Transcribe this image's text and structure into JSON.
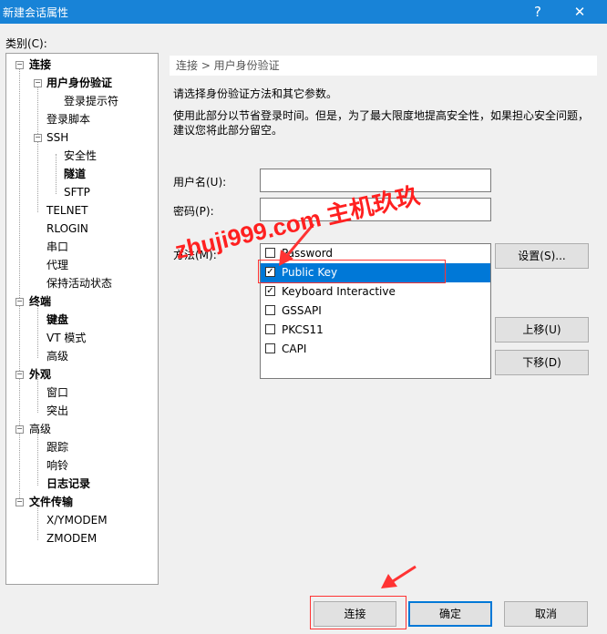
{
  "window": {
    "title": "新建会话属性",
    "help_button": "?",
    "close_button": "✕"
  },
  "category_label": "类别(C):",
  "tree": {
    "connection": "连接",
    "user_auth": "用户身份验证",
    "login_prompt": "登录提示符",
    "login_script": "登录脚本",
    "ssh": "SSH",
    "security": "安全性",
    "tunnel": "隧道",
    "sftp": "SFTP",
    "telnet": "TELNET",
    "rlogin": "RLOGIN",
    "serial": "串口",
    "proxy": "代理",
    "keepalive": "保持活动状态",
    "terminal": "终端",
    "keyboard": "键盘",
    "vt_mode": "VT 模式",
    "terminal_advanced": "高级",
    "appearance": "外观",
    "window": "窗口",
    "highlight": "突出",
    "advanced": "高级",
    "trace": "跟踪",
    "bell": "响铃",
    "logging": "日志记录",
    "file_transfer": "文件传输",
    "xymodem": "X/YMODEM",
    "zmodem": "ZMODEM"
  },
  "breadcrumb": "连接 > 用户身份验证",
  "description": {
    "line1": "请选择身份验证方法和其它参数。",
    "line2": "使用此部分以节省登录时间。但是，为了最大限度地提高安全性，如果担心安全问题，",
    "line3": "建议您将此部分留空。"
  },
  "form": {
    "username_label": "用户名(U):",
    "username_value": "",
    "password_label": "密码(P):",
    "password_value": "",
    "method_label": "方法(M):"
  },
  "methods": [
    {
      "label": "Password",
      "checked": false
    },
    {
      "label": "Public Key",
      "checked": true
    },
    {
      "label": "Keyboard Interactive",
      "checked": true
    },
    {
      "label": "GSSAPI",
      "checked": false
    },
    {
      "label": "PKCS11",
      "checked": false
    },
    {
      "label": "CAPI",
      "checked": false
    }
  ],
  "buttons": {
    "settings": "设置(S)...",
    "move_up": "上移(U)",
    "move_down": "下移(D)",
    "connect": "连接",
    "ok": "确定",
    "cancel": "取消"
  },
  "watermark": "zhuji999.com 主机玖玖",
  "colors": {
    "titlebar": "#1883d7",
    "selection": "#0078d7",
    "annotation": "#ff3333"
  }
}
